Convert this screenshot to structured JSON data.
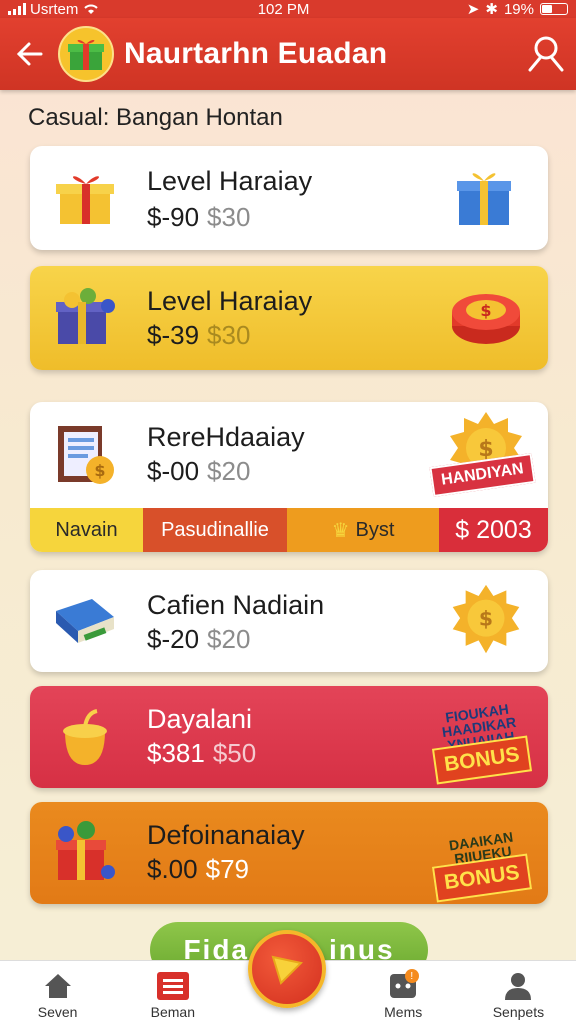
{
  "status": {
    "carrier": "Usrtem",
    "time": "102 PM",
    "battery": "19%"
  },
  "header": {
    "title": "Naurtarhn Euadan"
  },
  "category": "Casual: Bangan Hontan",
  "cards": [
    {
      "title": "Level Haraiay",
      "price": "$-90",
      "old_price": "$30"
    },
    {
      "title": "Level Haraiay",
      "price": "$-39",
      "old_price": "$30"
    },
    {
      "title": "RereHdaaiay",
      "price": "$-00",
      "old_price": "$20",
      "badge": "HANDIYAN"
    },
    {
      "title": "Cafien Nadiain",
      "price": "$-20",
      "old_price": "$20"
    },
    {
      "title": "Dayalani",
      "price": "$381",
      "old_price": "$50",
      "burst": "FIOUKAH HAADIKAR YNUAIIAH",
      "badge": "BONUS"
    },
    {
      "title": "Defoinanaiay",
      "price": "$.00",
      "old_price": "$79",
      "burst": "DAAIKAN RIIUEKU",
      "badge": "BONUS"
    }
  ],
  "tags": {
    "t1": "Navain",
    "t2": "Pasudinallie",
    "t3": "Byst",
    "t4": "$ 2003"
  },
  "green_button": {
    "left": "Fida",
    "right": "inus"
  },
  "tabs": [
    {
      "label": "Seven"
    },
    {
      "label": "Beman"
    },
    {
      "label": "Mems",
      "notification": "!"
    },
    {
      "label": "Senpets"
    }
  ]
}
